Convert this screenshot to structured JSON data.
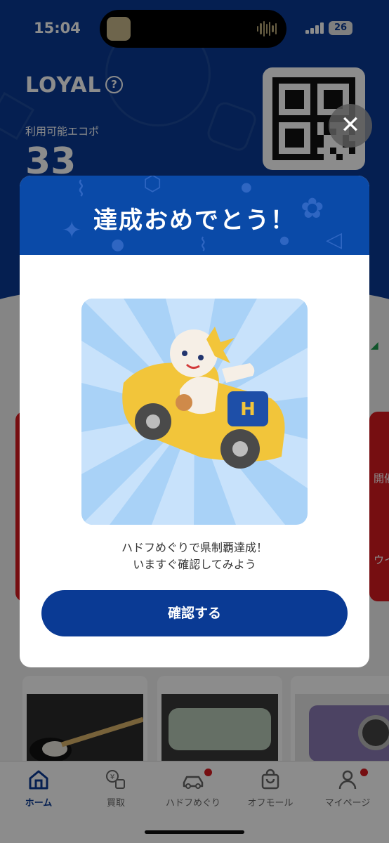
{
  "status_bar": {
    "time": "15:04",
    "battery": "26"
  },
  "header": {
    "brand": "LOYAL",
    "eco_label": "利用可能エコポ",
    "eco_value": "33"
  },
  "side_cards": {
    "right_text_1": "開催中",
    "right_text_2": "ウイ"
  },
  "modal": {
    "title": "達成おめでとう！",
    "message_line1": "ハドフめぐりで県制覇達成！",
    "message_line2": "いますぐ確認してみよう",
    "confirm_label": "確認する",
    "close_icon": "close-icon"
  },
  "tabbar": {
    "items": [
      {
        "label": "ホーム",
        "icon": "home-icon",
        "active": true
      },
      {
        "label": "買取",
        "icon": "exchange-icon",
        "active": false
      },
      {
        "label": "ハドフめぐり",
        "icon": "car-icon",
        "active": false,
        "badge": true
      },
      {
        "label": "オフモール",
        "icon": "shopping-bag-icon",
        "active": false
      },
      {
        "label": "マイページ",
        "icon": "person-icon",
        "active": false,
        "badge": true
      }
    ]
  },
  "colors": {
    "primary": "#0a3a94",
    "header_blue": "#0a4aa8",
    "accent_red": "#d71a20",
    "badge_red": "#d71a20"
  }
}
